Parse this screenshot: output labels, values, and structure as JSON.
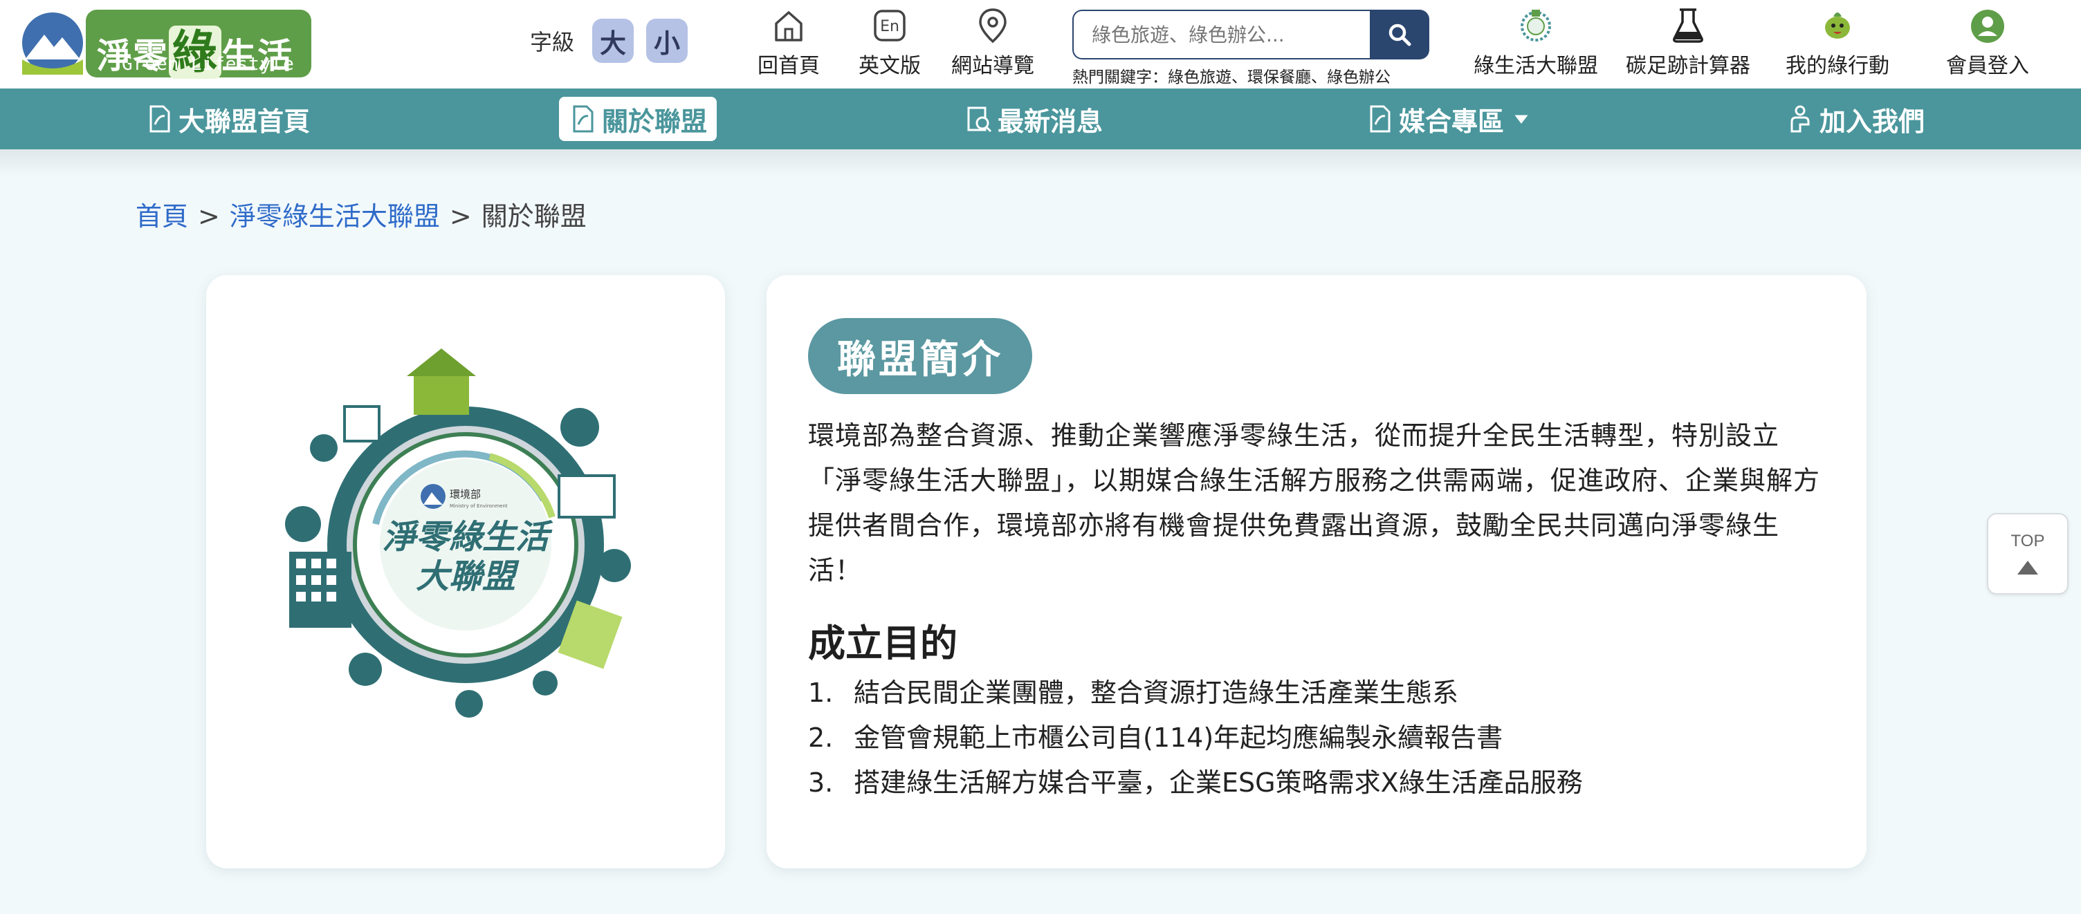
{
  "header": {
    "logo": {
      "title_pre": "淨零",
      "title_big": "綠",
      "title_post": "生活",
      "subtitle": "Green Lifestyle"
    },
    "font_size": {
      "label": "字級",
      "large": "大",
      "small": "小"
    },
    "utility_nav": [
      {
        "label": "回首頁",
        "icon": "home-icon"
      },
      {
        "label": "英文版",
        "icon": "english-icon"
      },
      {
        "label": "網站導覽",
        "icon": "map-pin-icon"
      }
    ],
    "search": {
      "placeholder": "綠色旅遊、綠色辦公...",
      "hot_keywords": "熱門關鍵字：綠色旅遊、環保餐廳、綠色辦公"
    },
    "right_nav": [
      {
        "label": "綠生活大聯盟",
        "icon": "alliance-icon"
      },
      {
        "label": "碳足跡計算器",
        "icon": "flask-icon"
      },
      {
        "label": "我的綠行動",
        "icon": "mascot-icon"
      },
      {
        "label": "會員登入",
        "icon": "user-icon"
      }
    ]
  },
  "main_nav": [
    {
      "label": "大聯盟首頁",
      "icon": "document-icon",
      "active": false
    },
    {
      "label": "關於聯盟",
      "icon": "document-icon",
      "active": true
    },
    {
      "label": "最新消息",
      "icon": "news-icon",
      "active": false
    },
    {
      "label": "媒合專區",
      "icon": "document-icon",
      "active": false,
      "dropdown": true
    },
    {
      "label": "加入我們",
      "icon": "handshake-icon",
      "active": false
    }
  ],
  "breadcrumb": {
    "items": [
      "首頁",
      "淨零綠生活大聯盟",
      "關於聯盟"
    ],
    "separator": ">"
  },
  "emblem": {
    "agency_name": "環境部",
    "agency_en": "Ministry of Environment",
    "line1": "淨零綠生活",
    "line2": "大聯盟"
  },
  "content": {
    "section_title": "聯盟簡介",
    "intro": "環境部為整合資源、推動企業響應淨零綠生活，從而提升全民生活轉型，特別設立「淨零綠生活大聯盟」，以期媒合綠生活解方服務之供需兩端，促進政府、企業與解方提供者間合作，環境部亦將有機會提供免費露出資源，鼓勵全民共同邁向淨零綠生活！",
    "purpose_title": "成立目的",
    "purposes": [
      {
        "num": "1.",
        "text": "結合民間企業團體，整合資源打造綠生活產業生態系"
      },
      {
        "num": "2.",
        "text": "金管會規範上市櫃公司自(114)年起均應編製永續報告書"
      },
      {
        "num": "3.",
        "text": "搭建綠生活解方媒合平臺，企業ESG策略需求X綠生活產品服務"
      }
    ]
  },
  "top_button": {
    "label": "TOP"
  },
  "colors": {
    "nav_teal": "#4a969c",
    "pill_teal": "#5b98a1",
    "search_navy": "#2a466f",
    "logo_green": "#5f9e48",
    "link_blue": "#2f6bc9",
    "font_btn": "#b5c2e6"
  }
}
